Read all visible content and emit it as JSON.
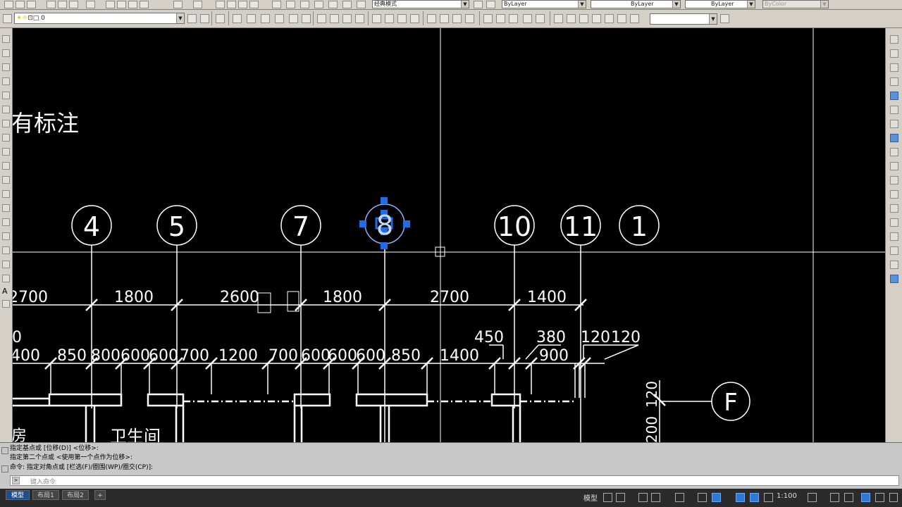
{
  "toolbar_top": {
    "workspace_value": "经典模式",
    "color_value": "ByLayer",
    "linetype_value": "ByLayer",
    "lineweight_value": "ByLayer",
    "plotstyle_value": "ByColor"
  },
  "toolbar_second": {
    "layer_value": "0",
    "textstyle_value": ""
  },
  "drawing": {
    "heading_text": "有标注",
    "axis_labels": [
      "4",
      "5",
      "7",
      "8",
      "10",
      "11",
      "1"
    ],
    "row_axis_label": "F",
    "dim_row1": [
      "2700",
      "1800",
      "2600",
      "1800",
      "2700",
      "1400"
    ],
    "dim_row2": [
      "450",
      "380",
      "120",
      "120"
    ],
    "dim_row3": [
      "400",
      "850",
      "800",
      "600",
      "600",
      "700",
      "1200",
      "700",
      "600",
      "600",
      "600",
      "850",
      "1400",
      "900"
    ],
    "dim_left_partial": "0",
    "dim_vertical_120": "120",
    "dim_vertical_200": "200",
    "room_text": "卫生间",
    "room_left_text": "房"
  },
  "command": {
    "lines": [
      "指定基点或 [位移(D)] <位移>:",
      "指定第二个点或 <使用第一个点作为位移>:",
      "命令: 指定对角点或 [栏选(F)/圈围(WP)/圈交(CP)]:"
    ],
    "placeholder": "键入命令"
  },
  "status": {
    "tabs": [
      "模型",
      "布局1",
      "布局2"
    ],
    "add_tab": "+",
    "model_label": "模型",
    "scale": "1:100"
  },
  "colors": {
    "background": "#000000",
    "drawing_lines": "#ffffff",
    "grip": "#1e6fe6",
    "toolbar": "#d4d0c8",
    "statusbar": "#2b2b2b"
  }
}
